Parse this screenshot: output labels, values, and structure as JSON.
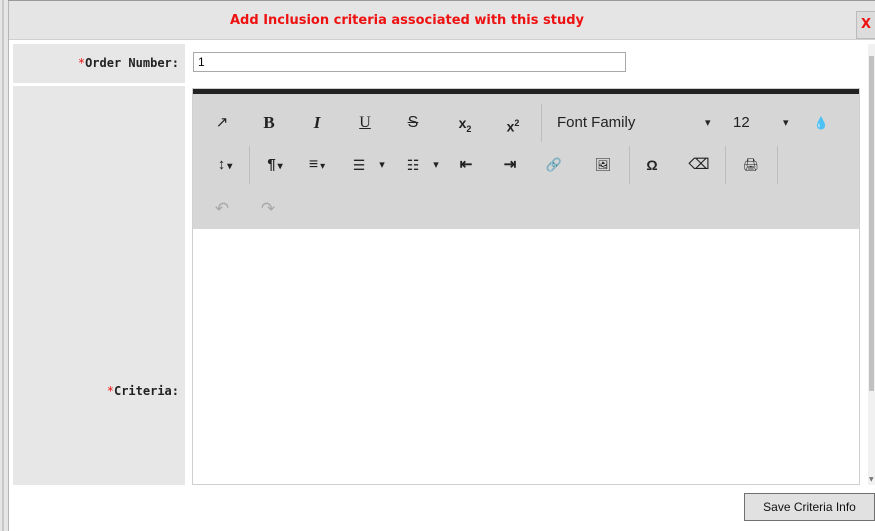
{
  "dialog": {
    "title": "Add Inclusion criteria associated with this study",
    "close_label": "X"
  },
  "form": {
    "order_number": {
      "required_mark": "*",
      "label": "Order Number:",
      "value": "1"
    },
    "criteria": {
      "required_mark": "*",
      "label": "Criteria:",
      "value": ""
    }
  },
  "toolbar": {
    "fullscreen_icon": "↗",
    "bold": "B",
    "italic": "I",
    "underline": "U",
    "strikethrough": "S",
    "subscript_base": "x",
    "subscript_mark": "2",
    "superscript_base": "x",
    "superscript_mark": "2",
    "font_family": "Font Family",
    "font_size": "12",
    "color_icon": "💧",
    "line_height_icon": "↕",
    "paragraph_icon": "¶",
    "align_icon": "≡",
    "ordered_list_icon": "☰",
    "unordered_list_icon": "☷",
    "outdent_icon": "⇤",
    "indent_icon": "⇥",
    "link_icon": "🔗",
    "image_icon": "🖼",
    "special_chars": "Ω",
    "eraser_icon": "⌫",
    "print_icon": "🖨",
    "undo_icon": "↶",
    "redo_icon": "↷",
    "caret": "▾"
  },
  "buttons": {
    "save": "Save Criteria Info"
  },
  "colors": {
    "title_red": "#ee1111",
    "label_bg": "#e7e7e7",
    "toolbar_bg": "#d6d6d6",
    "button_bg": "#e1e1e1"
  }
}
